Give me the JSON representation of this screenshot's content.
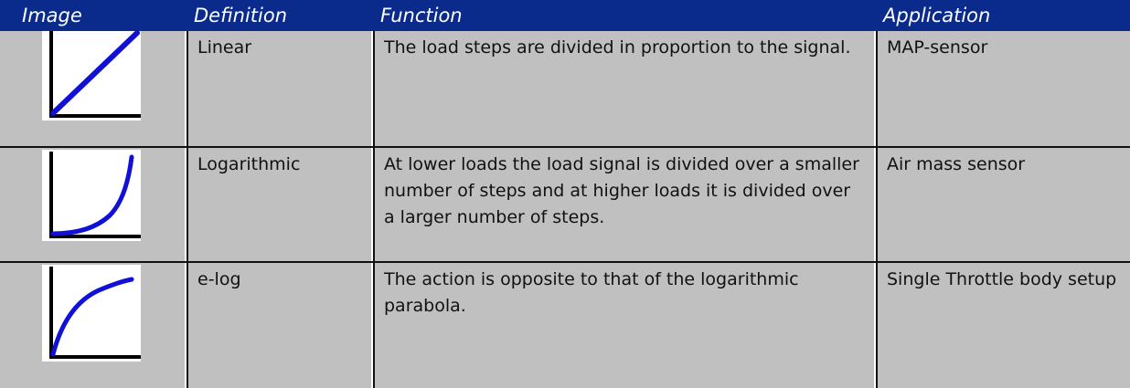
{
  "table": {
    "headers": {
      "image": "Image",
      "definition": "Definition",
      "function": "Function",
      "application": "Application"
    },
    "rows": [
      {
        "image_icon": "linear-curve-icon",
        "definition": "Linear",
        "function": "The load steps are divided in proportion to the signal.",
        "application": "MAP-sensor"
      },
      {
        "image_icon": "logarithmic-curve-icon",
        "definition": "Logarithmic",
        "function": "At lower loads the load signal is divided over a smaller number of steps and at higher loads it is divided over a larger number of steps.",
        "application": "Air mass sensor"
      },
      {
        "image_icon": "elog-curve-icon",
        "definition": "e-log",
        "function": "The action is opposite to that of the logarithmic parabola.",
        "application": "Single Throttle body setup"
      }
    ]
  },
  "colors": {
    "header_bg": "#0a2a8c",
    "header_text": "#ffffff",
    "cell_bg": "#c0c0c0",
    "curve": "#1010d8",
    "axis": "#000000"
  }
}
